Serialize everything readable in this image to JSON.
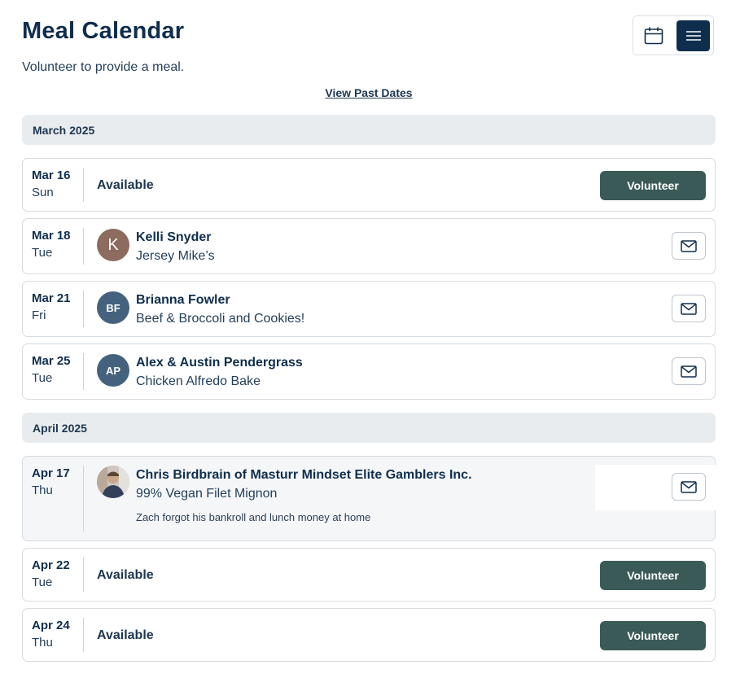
{
  "header": {
    "title": "Meal Calendar",
    "subtitle": "Volunteer to provide a meal."
  },
  "view_toggle": {
    "calendar_icon": "calendar-icon",
    "list_icon": "menu-icon",
    "active": "list"
  },
  "past_link": "View Past Dates",
  "months": [
    {
      "label": "March 2025"
    },
    {
      "label": "April 2025"
    }
  ],
  "entries": [
    {
      "date": "Mar 16",
      "day": "Sun",
      "status": "Available",
      "button": "Volunteer"
    },
    {
      "date": "Mar 18",
      "day": "Tue",
      "initials": "K",
      "name": "Kelli Snyder",
      "meal": "Jersey Mike’s"
    },
    {
      "date": "Mar 21",
      "day": "Fri",
      "initials": "BF",
      "name": "Brianna Fowler",
      "meal": "Beef & Broccoli and Cookies!"
    },
    {
      "date": "Mar 25",
      "day": "Tue",
      "initials": "AP",
      "name": "Alex & Austin Pendergrass",
      "meal": "Chicken Alfredo Bake"
    },
    {
      "date": "Apr 17",
      "day": "Thu",
      "name": "Chris Birdbrain of Masturr Mindset Elite Gamblers Inc.",
      "meal": "99% Vegan Filet Mignon",
      "note": "Zach forgot his bankroll and lunch money at home"
    },
    {
      "date": "Apr 22",
      "day": "Tue",
      "status": "Available",
      "button": "Volunteer"
    },
    {
      "date": "Apr 24",
      "day": "Thu",
      "status": "Available",
      "button": "Volunteer"
    }
  ],
  "colors": {
    "navy": "#0f2e4d",
    "volunteer_button": "#3a5a57",
    "month_header_bg": "#e9ecee",
    "avatar_brown": "#8d6b5e",
    "avatar_slate": "#44627d"
  }
}
